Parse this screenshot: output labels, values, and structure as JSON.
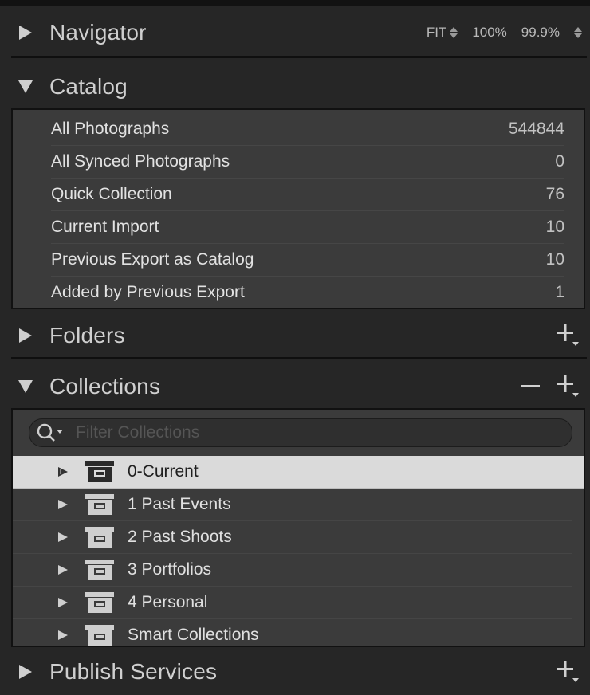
{
  "navigator": {
    "title": "Navigator",
    "zoom_options": [
      "FIT",
      "100%",
      "99.9%"
    ]
  },
  "catalog": {
    "title": "Catalog",
    "items": [
      {
        "label": "All Photographs",
        "count": "544844"
      },
      {
        "label": "All Synced Photographs",
        "count": "0"
      },
      {
        "label": "Quick Collection",
        "count": "76"
      },
      {
        "label": "Current Import",
        "count": "10"
      },
      {
        "label": "Previous Export as Catalog",
        "count": "10"
      },
      {
        "label": "Added by Previous Export",
        "count": "1"
      }
    ]
  },
  "folders": {
    "title": "Folders"
  },
  "collections": {
    "title": "Collections",
    "filter_placeholder": "Filter Collections",
    "items": [
      {
        "label": "0-Current",
        "selected": true
      },
      {
        "label": "1 Past Events",
        "selected": false
      },
      {
        "label": "2 Past Shoots",
        "selected": false
      },
      {
        "label": "3 Portfolios",
        "selected": false
      },
      {
        "label": "4 Personal",
        "selected": false
      },
      {
        "label": "Smart Collections",
        "selected": false
      }
    ]
  },
  "publish_services": {
    "title": "Publish Services"
  },
  "icons": {
    "expand": "triangle-right-icon",
    "collapse": "triangle-down-icon",
    "add": "plus-icon",
    "remove": "minus-icon",
    "collection_set": "collection-set-box-icon",
    "search": "search-icon"
  },
  "colors": {
    "panel_bg": "#262626",
    "list_bg": "#3b3b3b",
    "selected_row": "#dadada",
    "text": "#dcdcdc"
  }
}
